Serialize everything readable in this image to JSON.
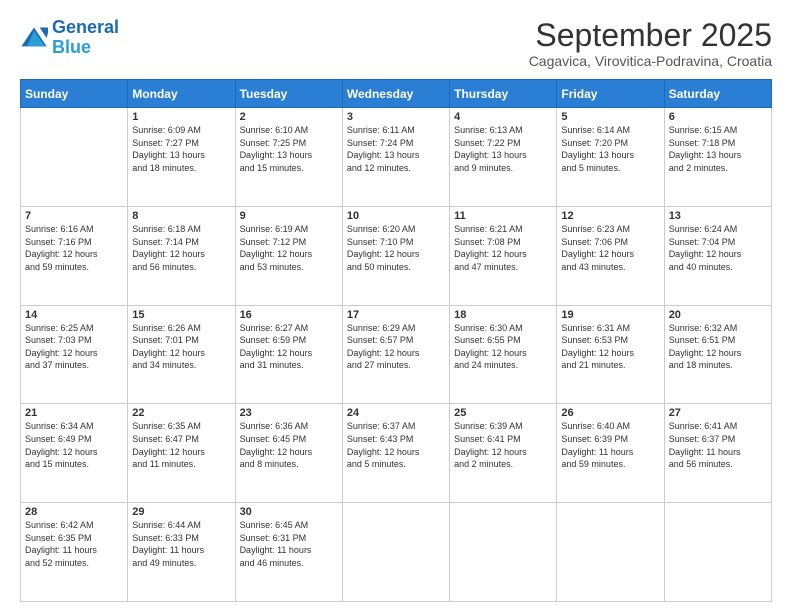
{
  "header": {
    "logo_line1": "General",
    "logo_line2": "Blue",
    "title": "September 2025",
    "location": "Cagavica, Virovitica-Podravina, Croatia"
  },
  "days_of_week": [
    "Sunday",
    "Monday",
    "Tuesday",
    "Wednesday",
    "Thursday",
    "Friday",
    "Saturday"
  ],
  "weeks": [
    [
      {
        "day": "",
        "info": ""
      },
      {
        "day": "1",
        "info": "Sunrise: 6:09 AM\nSunset: 7:27 PM\nDaylight: 13 hours\nand 18 minutes."
      },
      {
        "day": "2",
        "info": "Sunrise: 6:10 AM\nSunset: 7:25 PM\nDaylight: 13 hours\nand 15 minutes."
      },
      {
        "day": "3",
        "info": "Sunrise: 6:11 AM\nSunset: 7:24 PM\nDaylight: 13 hours\nand 12 minutes."
      },
      {
        "day": "4",
        "info": "Sunrise: 6:13 AM\nSunset: 7:22 PM\nDaylight: 13 hours\nand 9 minutes."
      },
      {
        "day": "5",
        "info": "Sunrise: 6:14 AM\nSunset: 7:20 PM\nDaylight: 13 hours\nand 5 minutes."
      },
      {
        "day": "6",
        "info": "Sunrise: 6:15 AM\nSunset: 7:18 PM\nDaylight: 13 hours\nand 2 minutes."
      }
    ],
    [
      {
        "day": "7",
        "info": "Sunrise: 6:16 AM\nSunset: 7:16 PM\nDaylight: 12 hours\nand 59 minutes."
      },
      {
        "day": "8",
        "info": "Sunrise: 6:18 AM\nSunset: 7:14 PM\nDaylight: 12 hours\nand 56 minutes."
      },
      {
        "day": "9",
        "info": "Sunrise: 6:19 AM\nSunset: 7:12 PM\nDaylight: 12 hours\nand 53 minutes."
      },
      {
        "day": "10",
        "info": "Sunrise: 6:20 AM\nSunset: 7:10 PM\nDaylight: 12 hours\nand 50 minutes."
      },
      {
        "day": "11",
        "info": "Sunrise: 6:21 AM\nSunset: 7:08 PM\nDaylight: 12 hours\nand 47 minutes."
      },
      {
        "day": "12",
        "info": "Sunrise: 6:23 AM\nSunset: 7:06 PM\nDaylight: 12 hours\nand 43 minutes."
      },
      {
        "day": "13",
        "info": "Sunrise: 6:24 AM\nSunset: 7:04 PM\nDaylight: 12 hours\nand 40 minutes."
      }
    ],
    [
      {
        "day": "14",
        "info": "Sunrise: 6:25 AM\nSunset: 7:03 PM\nDaylight: 12 hours\nand 37 minutes."
      },
      {
        "day": "15",
        "info": "Sunrise: 6:26 AM\nSunset: 7:01 PM\nDaylight: 12 hours\nand 34 minutes."
      },
      {
        "day": "16",
        "info": "Sunrise: 6:27 AM\nSunset: 6:59 PM\nDaylight: 12 hours\nand 31 minutes."
      },
      {
        "day": "17",
        "info": "Sunrise: 6:29 AM\nSunset: 6:57 PM\nDaylight: 12 hours\nand 27 minutes."
      },
      {
        "day": "18",
        "info": "Sunrise: 6:30 AM\nSunset: 6:55 PM\nDaylight: 12 hours\nand 24 minutes."
      },
      {
        "day": "19",
        "info": "Sunrise: 6:31 AM\nSunset: 6:53 PM\nDaylight: 12 hours\nand 21 minutes."
      },
      {
        "day": "20",
        "info": "Sunrise: 6:32 AM\nSunset: 6:51 PM\nDaylight: 12 hours\nand 18 minutes."
      }
    ],
    [
      {
        "day": "21",
        "info": "Sunrise: 6:34 AM\nSunset: 6:49 PM\nDaylight: 12 hours\nand 15 minutes."
      },
      {
        "day": "22",
        "info": "Sunrise: 6:35 AM\nSunset: 6:47 PM\nDaylight: 12 hours\nand 11 minutes."
      },
      {
        "day": "23",
        "info": "Sunrise: 6:36 AM\nSunset: 6:45 PM\nDaylight: 12 hours\nand 8 minutes."
      },
      {
        "day": "24",
        "info": "Sunrise: 6:37 AM\nSunset: 6:43 PM\nDaylight: 12 hours\nand 5 minutes."
      },
      {
        "day": "25",
        "info": "Sunrise: 6:39 AM\nSunset: 6:41 PM\nDaylight: 12 hours\nand 2 minutes."
      },
      {
        "day": "26",
        "info": "Sunrise: 6:40 AM\nSunset: 6:39 PM\nDaylight: 11 hours\nand 59 minutes."
      },
      {
        "day": "27",
        "info": "Sunrise: 6:41 AM\nSunset: 6:37 PM\nDaylight: 11 hours\nand 56 minutes."
      }
    ],
    [
      {
        "day": "28",
        "info": "Sunrise: 6:42 AM\nSunset: 6:35 PM\nDaylight: 11 hours\nand 52 minutes."
      },
      {
        "day": "29",
        "info": "Sunrise: 6:44 AM\nSunset: 6:33 PM\nDaylight: 11 hours\nand 49 minutes."
      },
      {
        "day": "30",
        "info": "Sunrise: 6:45 AM\nSunset: 6:31 PM\nDaylight: 11 hours\nand 46 minutes."
      },
      {
        "day": "",
        "info": ""
      },
      {
        "day": "",
        "info": ""
      },
      {
        "day": "",
        "info": ""
      },
      {
        "day": "",
        "info": ""
      }
    ]
  ]
}
